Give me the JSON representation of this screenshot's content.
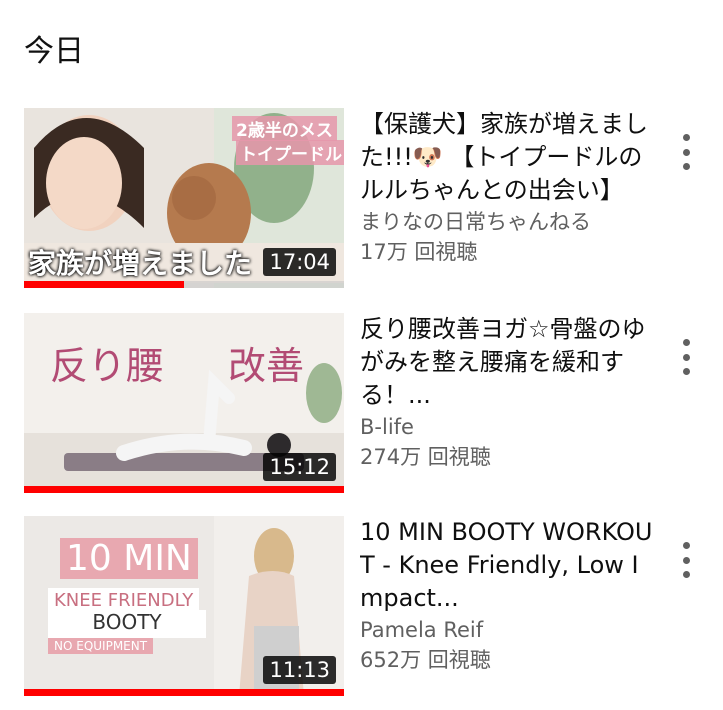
{
  "section": {
    "title": "今日"
  },
  "videos": [
    {
      "title": "【保護犬】家族が増えました!!!🐶 【トイプードルのルルちゃんとの出会い】",
      "channel": "まりなの日常ちゃんねる",
      "views": "17万 回視聴",
      "duration": "17:04",
      "thumb_text": [
        "2歳半のメス",
        "トイプードル",
        "家族が増えました"
      ],
      "watched_fraction": 0.5,
      "more_icon": "more-vert-icon"
    },
    {
      "title": "反り腰改善ヨガ☆骨盤のゆがみを整え腰痛を緩和する！...",
      "channel": "B-life",
      "views": "274万 回視聴",
      "duration": "15:12",
      "thumb_text": [
        "反り腰",
        "改善"
      ],
      "watched_fraction": 1.0,
      "more_icon": "more-vert-icon"
    },
    {
      "title": "10 MIN BOOTY WORKOUT - Knee Friendly, Low Impact...",
      "channel": "Pamela Reif",
      "views": "652万 回視聴",
      "duration": "11:13",
      "thumb_text": [
        "10 MIN",
        "KNEE FRIENDLY",
        "BOOTY",
        "NO EQUIPMENT"
      ],
      "watched_fraction": 1.0,
      "more_icon": "more-vert-icon"
    }
  ],
  "colors": {
    "progress": "#ff0000",
    "meta_text": "#606060"
  }
}
